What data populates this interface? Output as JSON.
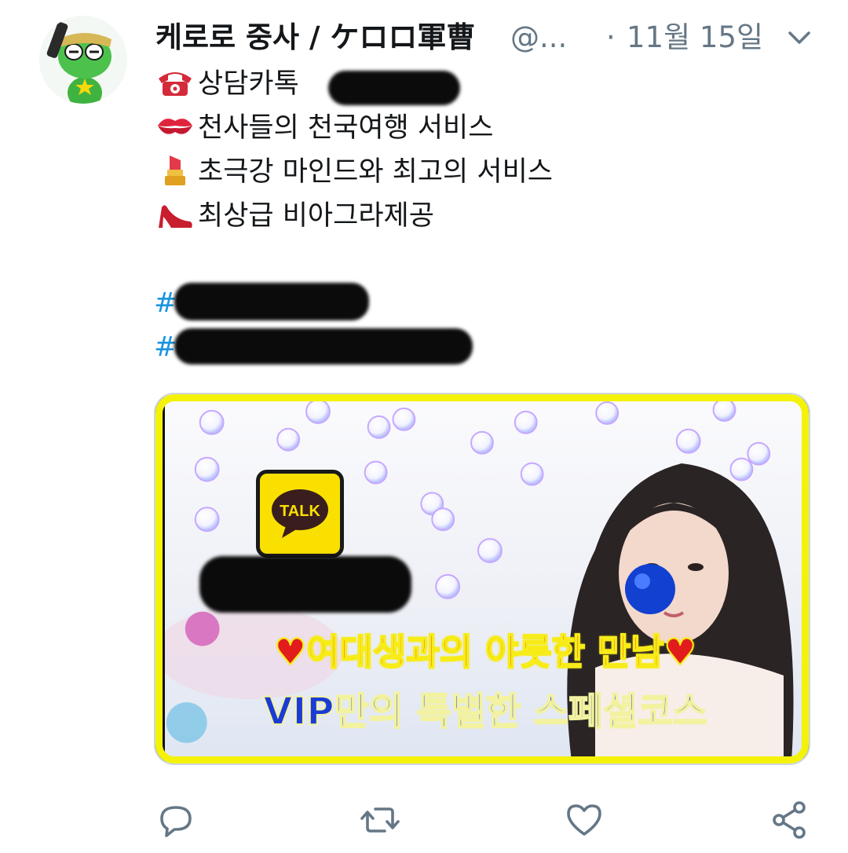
{
  "author": {
    "display_name": "케로로 중사 / ケロロ軍曹",
    "handle": "@...",
    "separator": "·",
    "date": "11월 15일"
  },
  "tweet": {
    "lines": [
      {
        "emoji": "telephone-icon",
        "text": "상담카톡"
      },
      {
        "emoji": "kiss-mark-icon",
        "text": "천사들의 천국여행 서비스"
      },
      {
        "emoji": "lipstick-icon",
        "text": "초극강 마인드와 최고의 서비스"
      },
      {
        "emoji": "high-heel-icon",
        "text": "최상급 비아그라제공"
      }
    ],
    "hashtags": [
      "#",
      "#"
    ]
  },
  "card": {
    "logo_text": "TALK",
    "caption_line1": "♥여대생과의 야릇한 만남♥",
    "caption_line2": "VIP만의 특별한 스페셜코스"
  },
  "actions": [
    "reply-icon",
    "retweet-icon",
    "like-icon",
    "share-icon"
  ],
  "colors": {
    "text": "#14171a",
    "secondary": "#657786",
    "link": "#1b95e0",
    "card_frame": "#f5f20a",
    "caption_red": "#e21c1c",
    "caption_blue": "#1b3bd6"
  }
}
